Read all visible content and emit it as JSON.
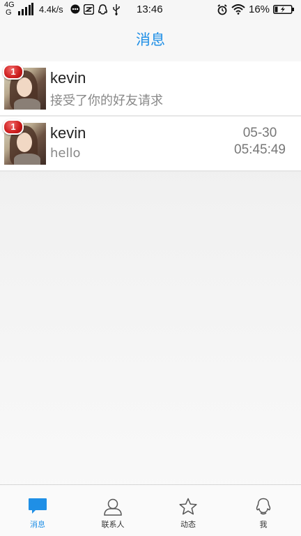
{
  "status_bar": {
    "network_top": "4G",
    "network_bottom": "G",
    "speed": "4.4k/s",
    "time": "13:46",
    "battery_percent": "16%"
  },
  "header": {
    "title": "消息"
  },
  "messages": [
    {
      "unread": "1",
      "name": "kevin",
      "preview": "接受了你的好友请求",
      "date": "",
      "time": ""
    },
    {
      "unread": "1",
      "name": "kevin",
      "preview": "hello",
      "date": "05-30",
      "time": "05:45:49"
    }
  ],
  "nav": [
    {
      "label": "消息",
      "icon": "chat-bubble-icon",
      "active": true
    },
    {
      "label": "联系人",
      "icon": "contacts-icon",
      "active": false
    },
    {
      "label": "动态",
      "icon": "star-icon",
      "active": false
    },
    {
      "label": "我",
      "icon": "profile-icon",
      "active": false
    }
  ],
  "colors": {
    "accent": "#1f8fe6",
    "badge": "#cc1d1d"
  }
}
